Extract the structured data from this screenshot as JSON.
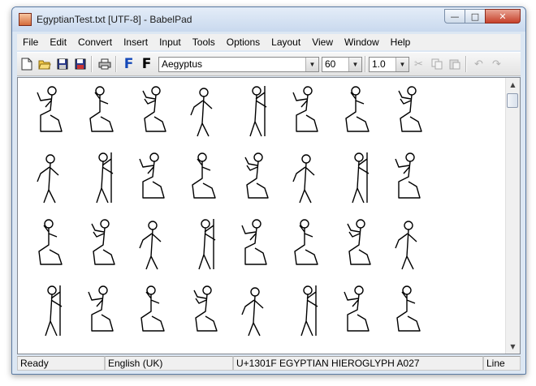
{
  "window": {
    "title": "EgyptianTest.txt [UTF-8] - BabelPad"
  },
  "titlebar_buttons": {
    "minimize": "—",
    "maximize": "□",
    "close": "✕"
  },
  "menu": [
    "File",
    "Edit",
    "Convert",
    "Insert",
    "Input",
    "Tools",
    "Options",
    "Layout",
    "View",
    "Window",
    "Help"
  ],
  "toolbar": {
    "font_name": "Aegyptus",
    "font_size": "60",
    "line_spacing": "1.0",
    "icons": [
      "new-file-icon",
      "open-folder-icon",
      "save-icon",
      "save-all-icon",
      "print-icon",
      "font-blue-icon",
      "font-black-icon",
      "cut-icon",
      "copy-icon",
      "paste-icon",
      "undo-icon",
      "redo-icon"
    ]
  },
  "document": {
    "rows": [
      [
        "A001",
        "A002",
        "A003",
        "A004",
        "A005",
        "A006",
        "A007",
        "A008"
      ],
      [
        "A009",
        "A010",
        "A011",
        "A012",
        "A013",
        "A014",
        "A015",
        "A016"
      ],
      [
        "A017",
        "A018",
        "A019",
        "A020",
        "A021",
        "A022",
        "A023",
        "A024"
      ],
      [
        "A025",
        "A026",
        "A027",
        "A028",
        "A029",
        "A030",
        "A031",
        "A032"
      ]
    ]
  },
  "status": {
    "ready": "Ready",
    "language": "English (UK)",
    "char_info": "U+1301F EGYPTIAN HIEROGLYPH A027",
    "line": "Line"
  },
  "colors": {
    "accent": "#dce7f3",
    "close": "#c7402a",
    "font_icon_blue": "#1448b8"
  }
}
